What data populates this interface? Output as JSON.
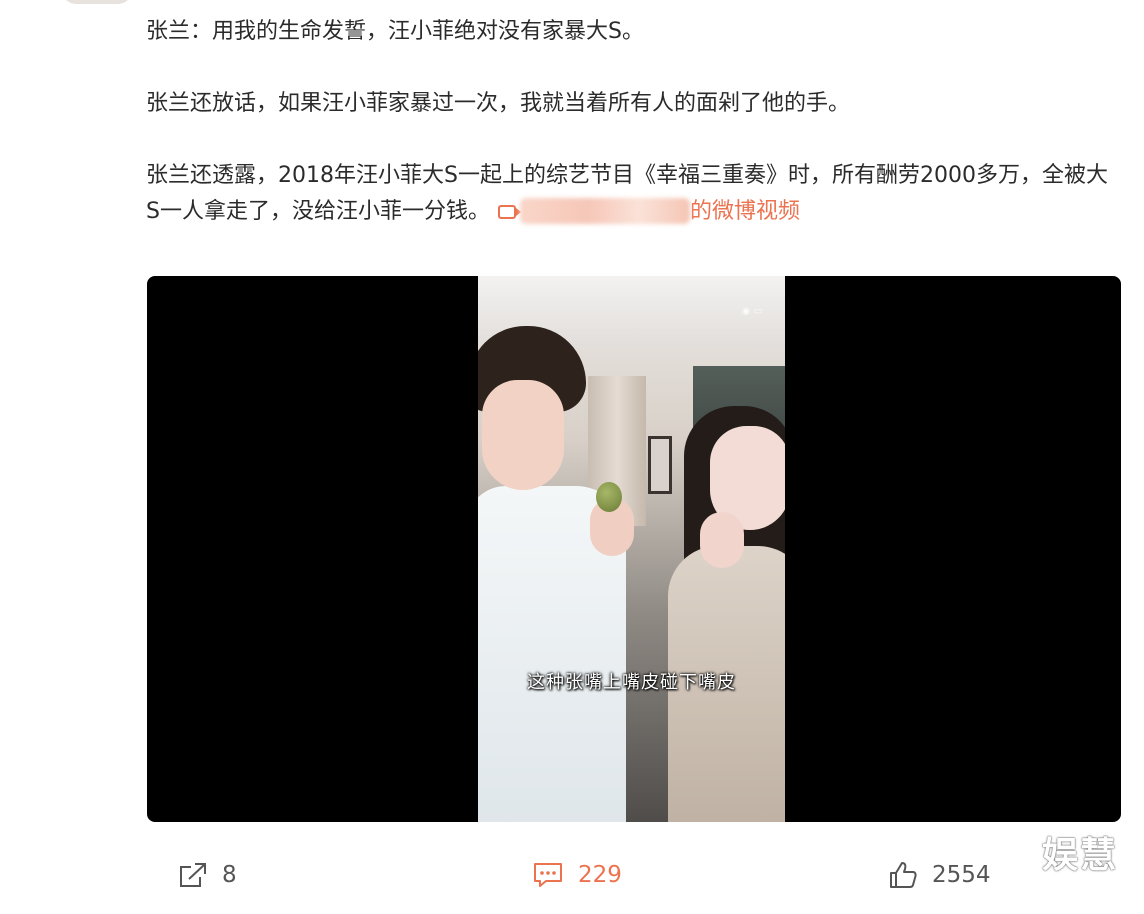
{
  "post": {
    "paragraphs": [
      "张兰：用我的生命发誓，汪小菲绝对没有家暴大S。",
      "张兰还放话，如果汪小菲家暴过一次，我就当着所有人的面剁了他的手。",
      "张兰还透露，2018年汪小菲大S一起上的综艺节目《幸福三重奏》时，所有酬劳2000多万，全被大S一人拿走了，没给汪小菲一分钱。"
    ],
    "video_link_suffix": "的微博视频"
  },
  "video": {
    "subtitle": "这种张嘴上嘴皮碰下嘴皮"
  },
  "actions": {
    "share_count": "8",
    "comment_count": "229",
    "like_count": "2554"
  },
  "watermark": {
    "text": "娱慧"
  },
  "colors": {
    "accent": "#eb7350",
    "text": "#2b2b2b",
    "muted": "#555555"
  },
  "icons": {
    "share": "share-icon",
    "comment": "comment-icon",
    "like": "thumbs-up-icon",
    "video_link": "video-camera-icon"
  }
}
